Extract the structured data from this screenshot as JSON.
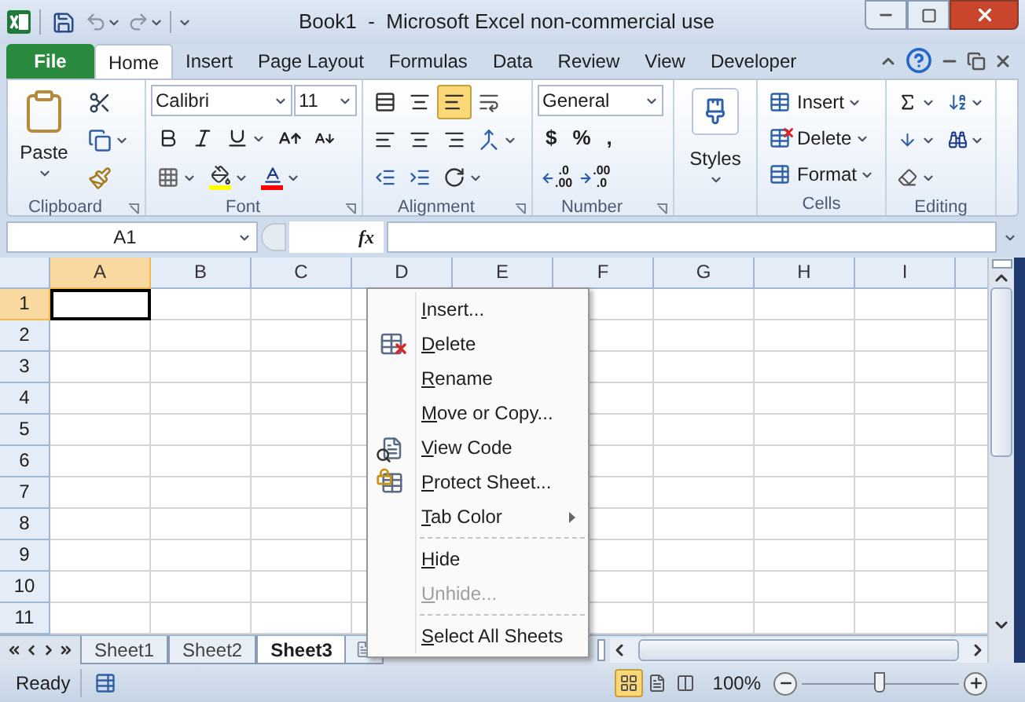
{
  "title_bar": {
    "title": "Book1  -  Microsoft Excel non-commercial use"
  },
  "ribbon_tabs": [
    {
      "label": "File",
      "kind": "file",
      "selected": false
    },
    {
      "label": "Home",
      "kind": "tab",
      "selected": true
    },
    {
      "label": "Insert",
      "kind": "tab",
      "selected": false
    },
    {
      "label": "Page Layout",
      "kind": "tab",
      "selected": false
    },
    {
      "label": "Formulas",
      "kind": "tab",
      "selected": false
    },
    {
      "label": "Data",
      "kind": "tab",
      "selected": false
    },
    {
      "label": "Review",
      "kind": "tab",
      "selected": false
    },
    {
      "label": "View",
      "kind": "tab",
      "selected": false
    },
    {
      "label": "Developer",
      "kind": "tab",
      "selected": false
    }
  ],
  "ribbon_groups": [
    {
      "kind": "clipboard",
      "label": "Clipboard",
      "launcher": true,
      "paste_label": "Paste"
    },
    {
      "kind": "font",
      "label": "Font",
      "launcher": true,
      "font_name": "Calibri",
      "font_size": "11"
    },
    {
      "kind": "alignment",
      "label": "Alignment",
      "launcher": true,
      "vertical": [
        {
          "kind": "top",
          "selected": false
        },
        {
          "kind": "middle",
          "selected": false
        },
        {
          "kind": "bottom",
          "selected": true
        }
      ]
    },
    {
      "kind": "number",
      "label": "Number",
      "launcher": true,
      "format": "General",
      "symbols": [
        "$",
        "%",
        ","
      ],
      "decimals": [
        {
          "kind": "increase",
          "top": ".0",
          "bottom": ".00"
        },
        {
          "kind": "decrease",
          "top": ".00",
          "bottom": ".0"
        }
      ]
    },
    {
      "kind": "styles",
      "button_label": "Styles"
    },
    {
      "kind": "cells",
      "label": "Cells",
      "launcher": false,
      "items": [
        {
          "kind": "insert",
          "label": "Insert"
        },
        {
          "kind": "delete",
          "label": "Delete"
        },
        {
          "kind": "format",
          "label": "Format"
        }
      ]
    },
    {
      "kind": "editing",
      "label": "Editing",
      "launcher": false
    }
  ],
  "formula_bar": {
    "name_box": "A1",
    "function_label": "fx"
  },
  "columns": [
    {
      "label": "A",
      "selected": true
    },
    {
      "label": "B",
      "selected": false
    },
    {
      "label": "C",
      "selected": false
    },
    {
      "label": "D",
      "selected": false
    },
    {
      "label": "E",
      "selected": false
    },
    {
      "label": "F",
      "selected": false
    },
    {
      "label": "G",
      "selected": false
    },
    {
      "label": "H",
      "selected": false
    },
    {
      "label": "I",
      "selected": false
    }
  ],
  "rows": [
    {
      "label": "1",
      "selected": true
    },
    {
      "label": "2",
      "selected": false
    },
    {
      "label": "3",
      "selected": false
    },
    {
      "label": "4",
      "selected": false
    },
    {
      "label": "5",
      "selected": false
    },
    {
      "label": "6",
      "selected": false
    },
    {
      "label": "7",
      "selected": false
    },
    {
      "label": "8",
      "selected": false
    },
    {
      "label": "9",
      "selected": false
    },
    {
      "label": "10",
      "selected": false
    },
    {
      "label": "11",
      "selected": false
    }
  ],
  "context_menu": [
    {
      "kind": "plain",
      "label": "Insert...",
      "disabled": false
    },
    {
      "kind": "delete",
      "label": "Delete",
      "disabled": false
    },
    {
      "kind": "plain",
      "label": "Rename",
      "disabled": false
    },
    {
      "kind": "plain",
      "label": "Move or Copy...",
      "disabled": false
    },
    {
      "kind": "view-code",
      "label": "View Code",
      "disabled": false
    },
    {
      "kind": "protect",
      "label": "Protect Sheet...",
      "disabled": false
    },
    {
      "kind": "submenu",
      "label": "Tab Color",
      "disabled": false
    },
    {
      "kind": "separator"
    },
    {
      "kind": "plain",
      "label": "Hide",
      "disabled": false
    },
    {
      "kind": "plain",
      "label": "Unhide...",
      "disabled": true
    },
    {
      "kind": "separator"
    },
    {
      "kind": "plain",
      "label": "Select All Sheets",
      "disabled": false
    }
  ],
  "sheet_tabs": [
    {
      "label": "Sheet1",
      "selected": false
    },
    {
      "label": "Sheet2",
      "selected": false
    },
    {
      "label": "Sheet3",
      "selected": true
    }
  ],
  "status_bar": {
    "status": "Ready",
    "views": [
      {
        "kind": "normal",
        "selected": true
      },
      {
        "kind": "page-layout",
        "selected": false
      },
      {
        "kind": "page-break",
        "selected": false
      }
    ],
    "zoom": "100%",
    "zoom_level": {
      "level": 0.5
    }
  }
}
